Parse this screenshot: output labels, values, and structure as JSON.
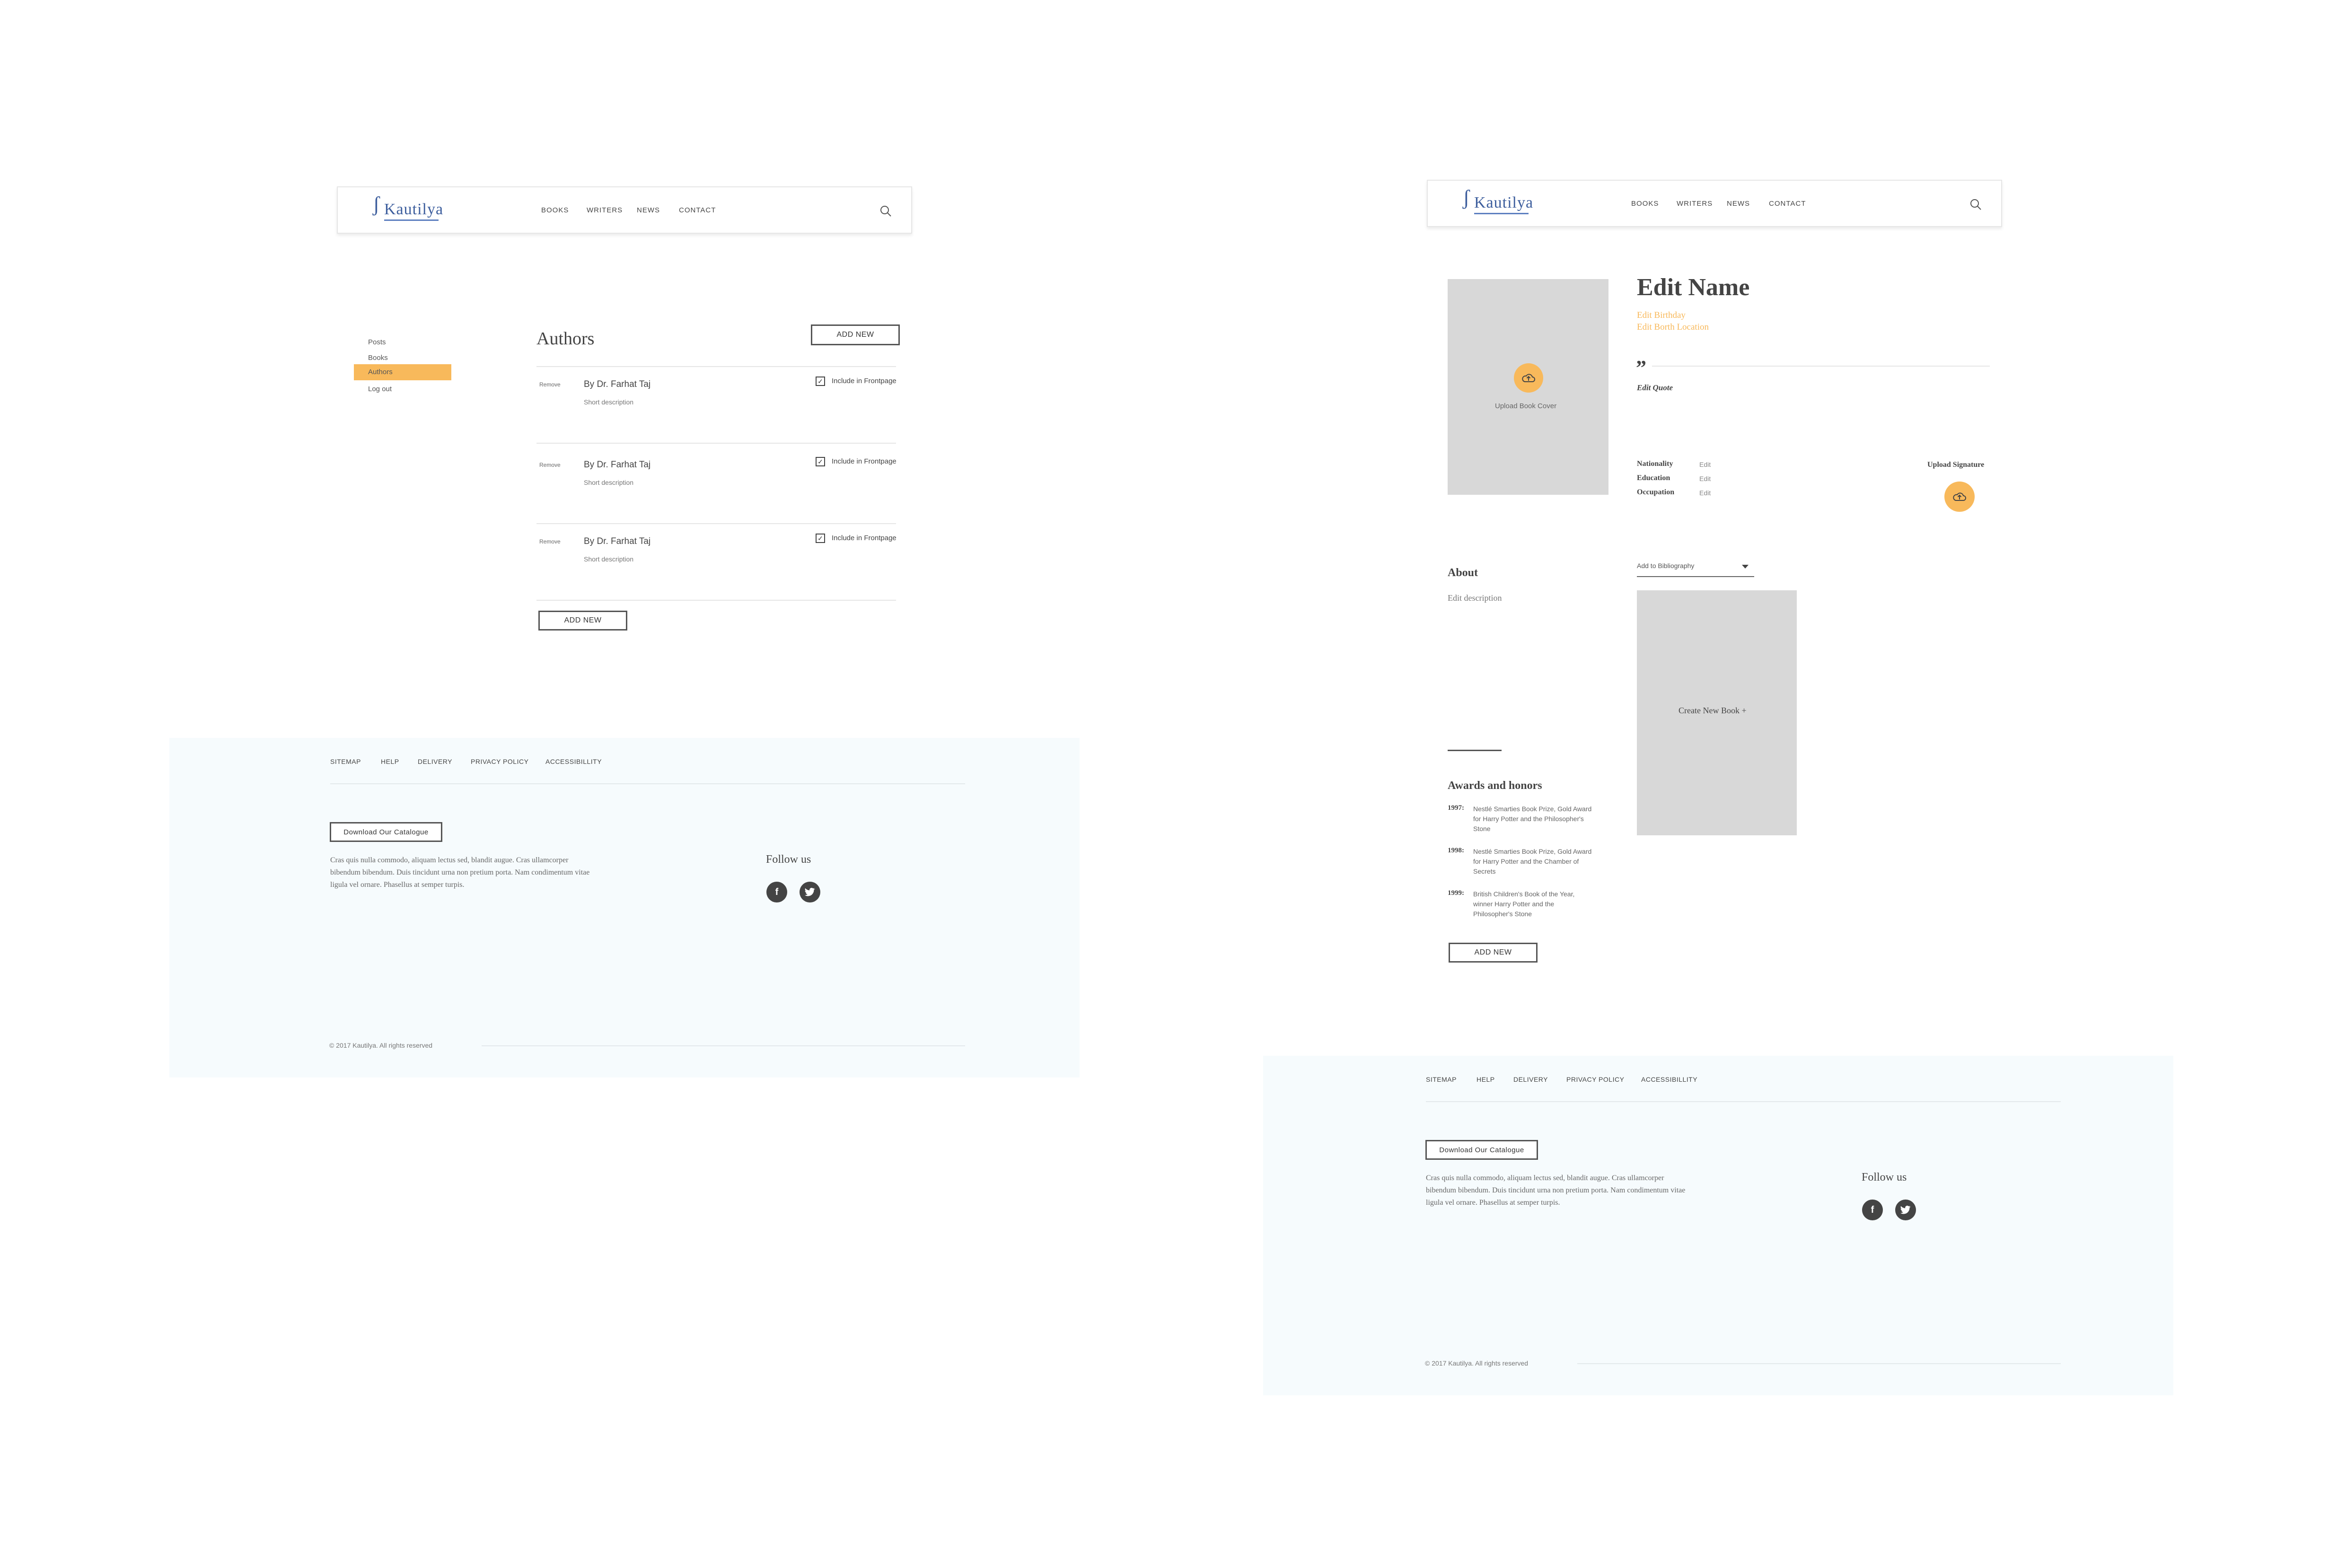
{
  "brand": {
    "name": "Kautilya"
  },
  "nav": [
    "BOOKS",
    "WRITERS",
    "NEWS",
    "CONTACT"
  ],
  "icons": {
    "search": "search-icon",
    "upload": "upload-icon",
    "facebook": "facebook-icon",
    "twitter": "twitter-icon",
    "check": "checkbox-checked-icon",
    "caret": "caret-down-icon"
  },
  "colors": {
    "accent": "#f8b95b",
    "brand": "#3e5f9e",
    "footer_bg": "#f6fbfd",
    "placeholder": "#d8d8d8"
  },
  "admin": {
    "sidebar": [
      "Posts",
      "Books",
      "Authors",
      "Log out"
    ],
    "active_item": "Authors",
    "title": "Authors",
    "add_new_top": "ADD NEW",
    "add_new_bottom": "ADD NEW",
    "rows": [
      {
        "remove": "Remove",
        "name": "By Dr. Farhat Taj",
        "desc": "Short description",
        "checkbox_label": "Include in Frontpage",
        "checked": true
      },
      {
        "remove": "Remove",
        "name": "By Dr. Farhat Taj",
        "desc": "Short description",
        "checkbox_label": "Include in Frontpage",
        "checked": true
      },
      {
        "remove": "Remove",
        "name": "By Dr. Farhat Taj",
        "desc": "Short description",
        "checkbox_label": "Include in Frontpage",
        "checked": true
      }
    ]
  },
  "footer": {
    "links": [
      "SITEMAP",
      "HELP",
      "DELIVERY",
      "PRIVACY POLICY",
      "ACCESSIBILLITY"
    ],
    "download": "Download Our Catalogue",
    "text_lines": [
      "Cras quis nulla commodo, aliquam lectus sed, blandit augue. Cras ullamcorper",
      "bibendum bibendum. Duis tincidunt urna non pretium porta. Nam condimentum vitae",
      "ligula vel ornare. Phasellus at semper turpis."
    ],
    "follow": "Follow us",
    "copyright": "© 2017 Kautilya. All rights reserved"
  },
  "editor": {
    "upload_cover": "Upload Book Cover",
    "name": "Edit Name",
    "birthday": "Edit Birthday",
    "birth_location": "Edit Borth Location",
    "quote_mark": "”",
    "quote": "Edit Quote",
    "fields": [
      {
        "label": "Nationality",
        "value": "Edit"
      },
      {
        "label": "Education",
        "value": "Edit"
      },
      {
        "label": "Occupation",
        "value": "Edit"
      }
    ],
    "upload_signature": "Upload Signature",
    "about_title": "About",
    "about_desc": "Edit description",
    "bibliography_select": "Add to Bibliography",
    "create_book": "Create New Book +",
    "awards_title": "Awards and honors",
    "awards": [
      {
        "year": "1997:",
        "lines": [
          "Nestlé Smarties Book Prize, Gold Award",
          "for Harry Potter and the Philosopher's",
          "Stone"
        ]
      },
      {
        "year": "1998:",
        "lines": [
          "Nestlé Smarties Book Prize, Gold Award",
          "for Harry Potter and the Chamber of",
          "Secrets"
        ]
      },
      {
        "year": "1999:",
        "lines": [
          "British Children's Book of the Year,",
          "winner Harry Potter and the",
          "Philosopher's Stone"
        ]
      }
    ],
    "add_new": "ADD NEW"
  }
}
